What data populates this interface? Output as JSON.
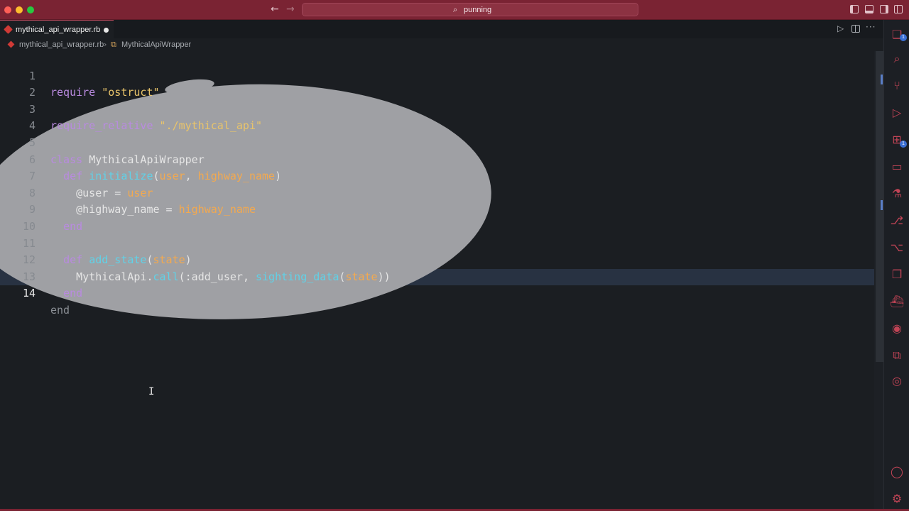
{
  "titlebar": {
    "search_text": "punning",
    "back_arrow": "←",
    "forward_arrow": "→",
    "search_glyph": "⌕"
  },
  "tab": {
    "filename": "mythical_api_wrapper.rb",
    "modified": true
  },
  "editor_actions": {
    "run_glyph": "▷",
    "more_glyph": "···"
  },
  "breadcrumbs": {
    "file": "mythical_api_wrapper.rb",
    "separator": "›",
    "class_glyph": "⧉",
    "symbol": "MythicalApiWrapper"
  },
  "code": {
    "active_line": 14,
    "lines": [
      {
        "n": "1"
      },
      {
        "n": "2"
      },
      {
        "n": "3"
      },
      {
        "n": "4"
      },
      {
        "n": "5"
      },
      {
        "n": "6"
      },
      {
        "n": "7"
      },
      {
        "n": "8"
      },
      {
        "n": "9"
      },
      {
        "n": "10"
      },
      {
        "n": "11"
      },
      {
        "n": "12"
      },
      {
        "n": "13"
      },
      {
        "n": "14"
      }
    ],
    "tokens": {
      "l1_kw": "require",
      "l1_str": "\"ostruct\"",
      "l3_kw": "require_relative",
      "l3_str": "\"./mythical_api\"",
      "l5_kw": "class",
      "l5_cls": "MythicalApiWrapper",
      "l6_kw": "def",
      "l6_fn": "initialize",
      "l6_open": "(",
      "l6_p1": "user",
      "l6_comma": ", ",
      "l6_p2": "highway_name",
      "l6_close": ")",
      "l7_ivar": "@user",
      "l7_eq": " = ",
      "l7_val": "user",
      "l8_ivar": "@highway_name",
      "l8_eq": " = ",
      "l8_val": "highway_name",
      "l9_kw": "end",
      "l11_kw": "def",
      "l11_fn": "add_state",
      "l11_open": "(",
      "l11_p": "state",
      "l11_close": ")",
      "l12_cls": "MythicalApi",
      "l12_dot": ".",
      "l12_fn": "call",
      "l12_open": "(",
      "l12_sym": ":add_user",
      "l12_comma": ", ",
      "l12_fn2": "sighting_data",
      "l12_open2": "(",
      "l12_p": "state",
      "l12_close": "))",
      "l13_kw": "end",
      "l14_kw": "end"
    }
  },
  "activity_bar": {
    "explorer_badge": "1",
    "extensions_badge": "1",
    "icons": [
      "files-icon",
      "search-icon",
      "source-control-icon",
      "run-debug-icon",
      "extensions-icon",
      "remote-explorer-icon",
      "testing-icon",
      "git-graph-icon",
      "git-lens-icon",
      "containers-icon",
      "docker-icon",
      "github-icon",
      "copilot-icon",
      "gitpod-icon",
      "account-icon",
      "settings-gear-icon"
    ]
  },
  "colors": {
    "titlebar": "#7a2333",
    "editor_bg": "#1b1e22",
    "accent": "#c24456",
    "highlight_overlay": "#9fa0a4"
  }
}
